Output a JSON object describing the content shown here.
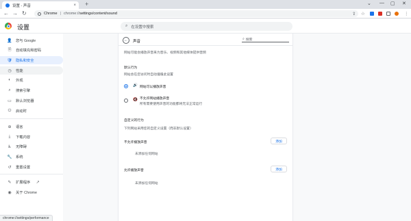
{
  "browser": {
    "tab_title": "设置 - 声音",
    "tab_close": "×",
    "new_tab": "+",
    "window_controls": [
      "⌄",
      "—",
      "▢",
      "✕"
    ],
    "site_label": "Chrome",
    "separator": "|",
    "url_prefix": "chrome://",
    "url_path": "settings/content/sound",
    "toolbar_icons": [
      "share-icon",
      "star-icon",
      "extension-icon",
      "window-icon",
      "profile-icon",
      "menu-icon"
    ],
    "toolbar_colors": {
      "ext_red": "#d93025",
      "ext_orange": "#e8710a",
      "ext_blue": "#1a73e8"
    }
  },
  "header": {
    "title": "设置",
    "search_placeholder": "在设置中搜索"
  },
  "sidebar": {
    "items": [
      {
        "icon": "👤",
        "label": "您与 Google",
        "active": false
      },
      {
        "icon": "🗎",
        "label": "自动填充和密码",
        "active": false
      },
      {
        "icon": "🛡",
        "label": "隐私和安全",
        "active": true
      },
      {
        "icon": "◷",
        "label": "性能",
        "active": false
      },
      {
        "icon": "◐",
        "label": "外观",
        "active": false
      },
      {
        "icon": "⌕",
        "label": "搜索引擎",
        "active": false
      },
      {
        "icon": "▭",
        "label": "默认浏览器",
        "active": false
      },
      {
        "icon": "⏻",
        "label": "启动时",
        "active": false
      },
      {
        "icon": "⊕",
        "label": "语言",
        "active": false
      },
      {
        "icon": "⤓",
        "label": "下载内容",
        "active": false
      },
      {
        "icon": "♿",
        "label": "无障碍",
        "active": false
      },
      {
        "icon": "🔧",
        "label": "系统",
        "active": false
      },
      {
        "icon": "↺",
        "label": "重置设置",
        "active": false
      },
      {
        "icon": "✎",
        "label": "扩展程序",
        "active": false
      },
      {
        "icon": "◉",
        "label": "关于 Chrome",
        "active": false
      }
    ],
    "external_link_icon": "↗"
  },
  "main": {
    "back_icon": "←",
    "title": "声音",
    "search_placeholder": "搜索",
    "description": "网站可能会播放声音来为音乐、视频和其他媒体提供音频",
    "default_behavior_heading": "默认行为",
    "default_behavior_desc": "网站会在您访问时自动遵循此设置",
    "option_allow": {
      "icon": "🔊",
      "label": "网站可以播放声音",
      "selected": true
    },
    "option_block": {
      "icon": "🔇",
      "label": "不允许网站播放声音",
      "sub": "所有需要使用声音的功能都将无法正常运行",
      "selected": false
    },
    "custom_heading": "自定义的行为",
    "custom_desc": "下列网站采用您的自定义设置（而非默认设置）",
    "blocked_heading": "不允许播放声音",
    "allowed_heading": "允许播放声音",
    "add_label": "添加",
    "empty_label": "未添加任何网站"
  },
  "status": {
    "text": "chrome://settings/performance"
  }
}
